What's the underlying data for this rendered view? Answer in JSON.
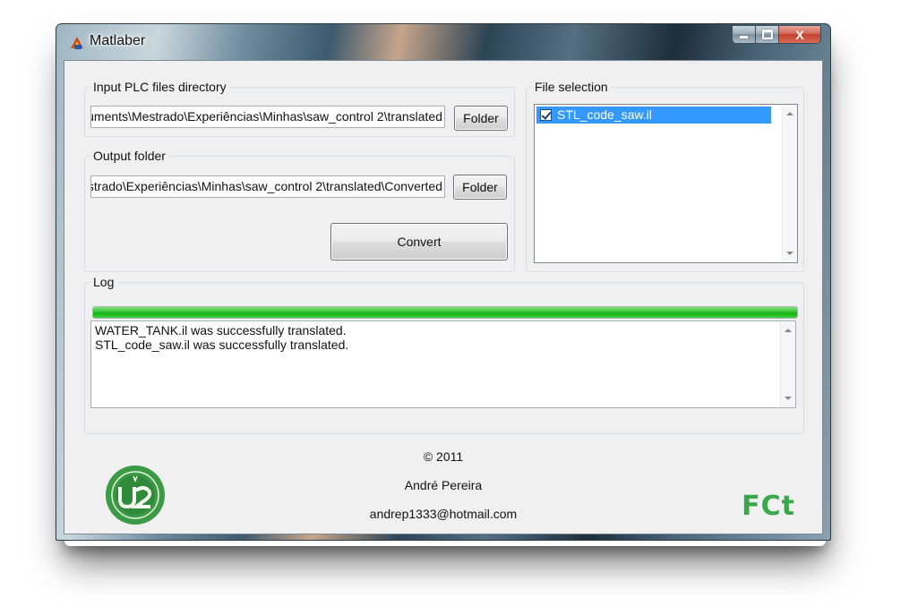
{
  "window": {
    "title": "Matlaber",
    "close_label": "X"
  },
  "input_group": {
    "label": "Input PLC files directory",
    "path": "C:\\Users\\André\\Documents\\Mestrado\\Experiências\\Minhas\\saw_control 2\\translated",
    "folder_button": "Folder"
  },
  "output_group": {
    "label": "Output folder",
    "path": "C:\\Users\\André\\Documents\\Mestrado\\Experiências\\Minhas\\saw_control 2\\translated\\Converted",
    "folder_button": "Folder",
    "convert_button": "Convert"
  },
  "file_selection": {
    "label": "File selection",
    "files": [
      {
        "name": "STL_code_saw.il",
        "checked": true,
        "selected": true
      }
    ]
  },
  "log": {
    "label": "Log",
    "progress_fraction": 1.0,
    "lines": [
      "WATER_TANK.il was successfully translated.",
      "STL_code_saw.il was successfully translated."
    ]
  },
  "footer": {
    "copyright": "© 2011",
    "author": "André Pereira",
    "email": "andrep1333@hotmail.com",
    "left_logo": "university-seal-logo",
    "right_logo": "FCt",
    "right_logo_color": "#3aa84a"
  }
}
